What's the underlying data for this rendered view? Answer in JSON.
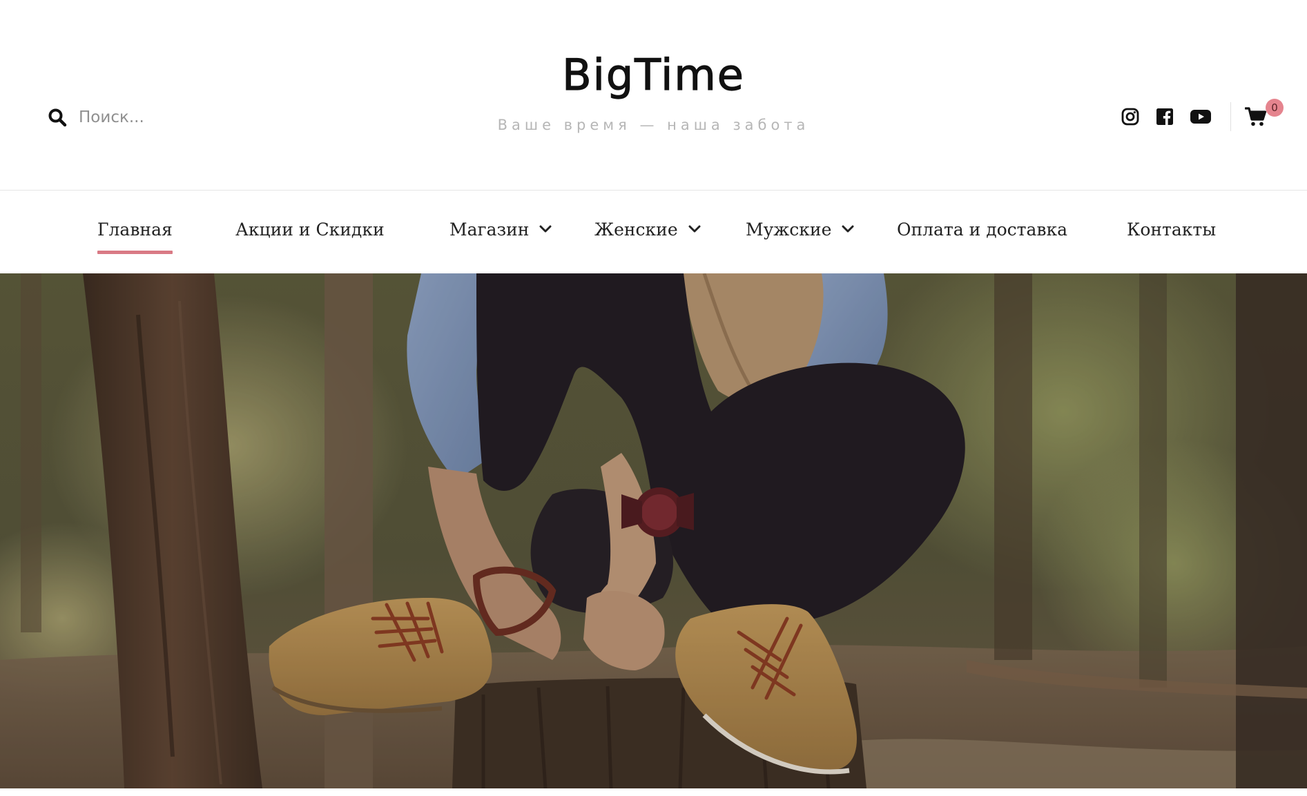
{
  "header": {
    "site_title": "BigTime",
    "tagline": "Ваше время — наша забота",
    "search": {
      "placeholder": "Поиск...",
      "icon": "search-icon"
    },
    "social": [
      {
        "name": "instagram",
        "icon": "instagram-icon"
      },
      {
        "name": "facebook",
        "icon": "facebook-icon"
      },
      {
        "name": "youtube",
        "icon": "youtube-icon"
      }
    ],
    "cart": {
      "icon": "cart-icon",
      "count": "0"
    }
  },
  "nav": {
    "items": [
      {
        "label": "Главная",
        "active": true,
        "has_dropdown": false
      },
      {
        "label": "Акции и Скидки",
        "active": false,
        "has_dropdown": false
      },
      {
        "label": "Магазин",
        "active": false,
        "has_dropdown": true
      },
      {
        "label": "Женские",
        "active": false,
        "has_dropdown": true
      },
      {
        "label": "Мужские",
        "active": false,
        "has_dropdown": true
      },
      {
        "label": "Оплата и доставка",
        "active": false,
        "has_dropdown": false
      },
      {
        "label": "Контакты",
        "active": false,
        "has_dropdown": false
      }
    ],
    "active_color": "#d97a85"
  },
  "hero": {
    "image": "person-sitting-on-stump-wearing-watch-and-boots-in-forest"
  },
  "colors": {
    "accent": "#e5848e",
    "text": "#111111",
    "muted": "#b6b6b6"
  }
}
